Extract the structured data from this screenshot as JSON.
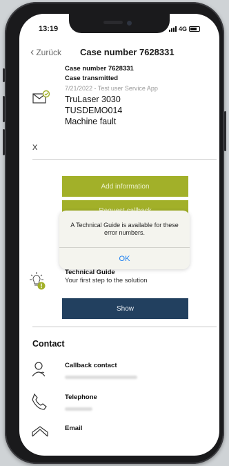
{
  "status": {
    "time": "13:19",
    "network": "4G"
  },
  "nav": {
    "back_label": "Zurück",
    "title": "Case number 7628331"
  },
  "case": {
    "number": "Case number 7628331",
    "state": "Case transmitted",
    "meta": "7/21/2022 - Test user Service App",
    "machine": "TruLaser 3030",
    "serial": "TUSDEMO014",
    "issue": "Machine fault",
    "x_mark": "X"
  },
  "actions": {
    "add_information": "Add information",
    "request_callback": "Request callback"
  },
  "technical_guide": {
    "title": "Technical Guide",
    "subtitle": "Your first step to the solution",
    "show_button": "Show"
  },
  "contact": {
    "section_title": "Contact",
    "callback_label": "Callback contact",
    "telephone_label": "Telephone",
    "email_label": "Email"
  },
  "dialog": {
    "message": "A Technical Guide is available for these error numbers.",
    "ok_label": "OK"
  },
  "colors": {
    "accent_green": "#a2b029",
    "navy": "#22405f",
    "ios_blue": "#1a7ef0"
  }
}
